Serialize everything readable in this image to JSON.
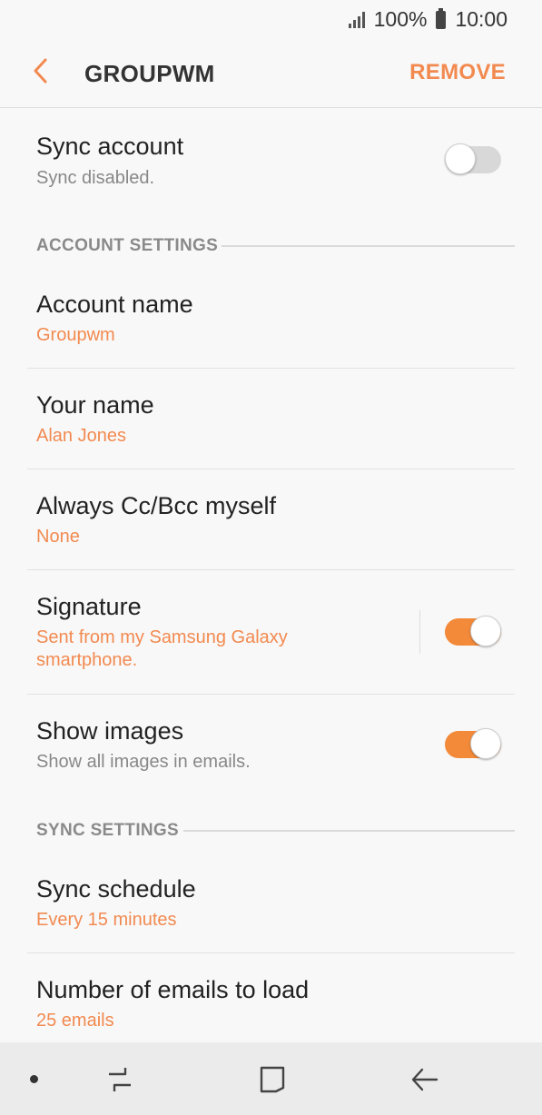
{
  "status_bar": {
    "battery_percent": "100%",
    "time": "10:00"
  },
  "app_bar": {
    "title": "GROUPWM",
    "remove_label": "REMOVE"
  },
  "sync_account": {
    "title": "Sync account",
    "subtitle": "Sync disabled.",
    "enabled": false
  },
  "sections": {
    "account_settings": "ACCOUNT SETTINGS",
    "sync_settings": "SYNC SETTINGS"
  },
  "account_name": {
    "title": "Account name",
    "value": "Groupwm"
  },
  "your_name": {
    "title": "Your name",
    "value": "Alan Jones"
  },
  "cc_bcc": {
    "title": "Always Cc/Bcc myself",
    "value": "None"
  },
  "signature": {
    "title": "Signature",
    "value_line1": "Sent from my Samsung Galaxy",
    "value_line2": "smartphone.",
    "enabled": true
  },
  "show_images": {
    "title": "Show images",
    "subtitle": "Show all images in emails.",
    "enabled": true
  },
  "sync_schedule": {
    "title": "Sync schedule",
    "value": "Every 15 minutes"
  },
  "emails_to_load": {
    "title": "Number of emails to load",
    "value": "25 emails"
  },
  "colors": {
    "accent": "#f28a50",
    "toggle_on": "#f28a3a",
    "toggle_off": "#d8d8d8"
  },
  "icons": {
    "back": "chevron-left-icon",
    "recents": "recents-icon",
    "home": "home-icon",
    "nav_back": "back-arrow-icon"
  }
}
